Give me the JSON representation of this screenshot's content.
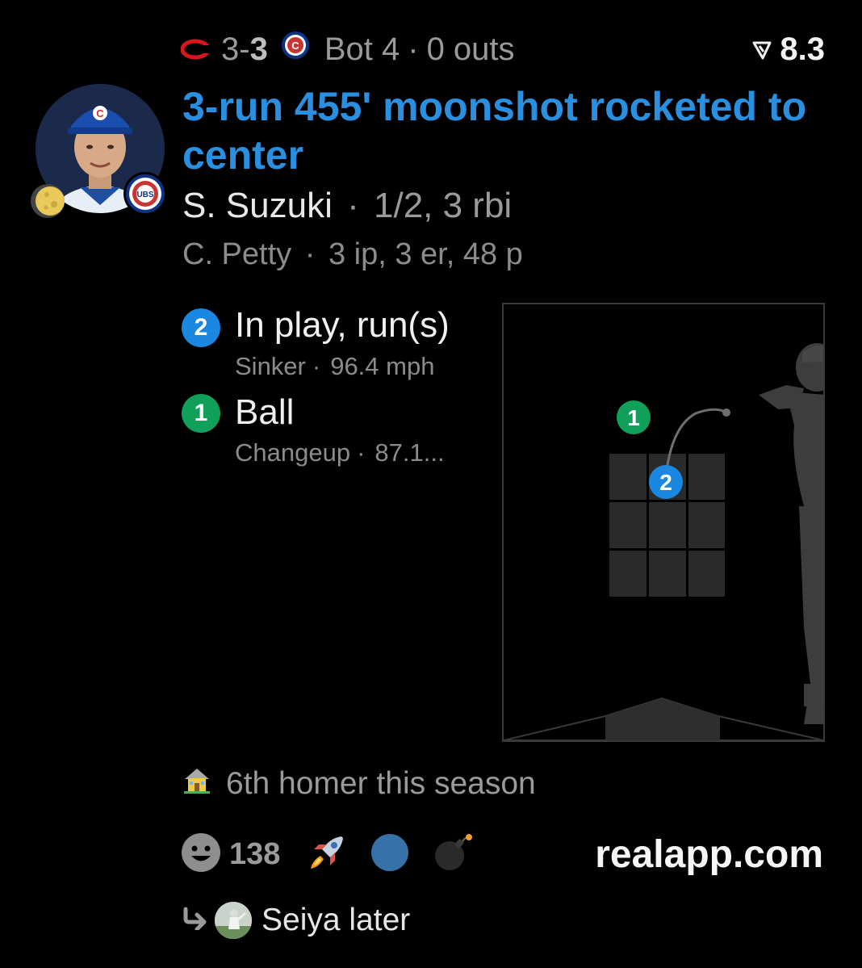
{
  "scoreboard": {
    "away_team_icon": "reds-logo-icon",
    "away_score": "3",
    "dash": "-",
    "home_score": "3",
    "home_team_icon": "cubs-logo-icon",
    "inning": "Bot 4",
    "outs": "0 outs",
    "separator": "·",
    "rating_icon": "rating-arrow-icon",
    "rating": "8.3"
  },
  "play": {
    "headline": "3-run 455' moonshot rocketed to center",
    "batter_name": "S. Suzuki",
    "batter_stats": "1/2, 3 rbi",
    "pitcher_name": "C. Petty",
    "pitcher_stats": "3 ip, 3 er, 48 p",
    "avatar_icon": "player-headshot",
    "badge_icons": [
      "moon-icon",
      "cubs-badge-icon"
    ]
  },
  "pitches": [
    {
      "number": "2",
      "result": "In play, run(s)",
      "pitch_type": "Sinker",
      "speed": "96.4 mph",
      "color": "#1a88e0"
    },
    {
      "number": "1",
      "result": "Ball",
      "pitch_type": "Changeup",
      "speed": "87.1...",
      "color": "#11a05a"
    }
  ],
  "footer": {
    "homer_icon": "house-icon",
    "homer_note": "6th homer this season",
    "reaction_icons": [
      "smiley-icon",
      "rocket-icon",
      "blue-circle-icon",
      "bomb-icon"
    ],
    "reaction_count": "138",
    "site": "realapp.com",
    "reply_icon": "reply-arrow-icon",
    "reply_text": "Seiya later"
  },
  "colors": {
    "accent": "#2b8fe0",
    "background": "#000000",
    "muted": "#9a9a9a",
    "zone": "#2a2a2a"
  }
}
